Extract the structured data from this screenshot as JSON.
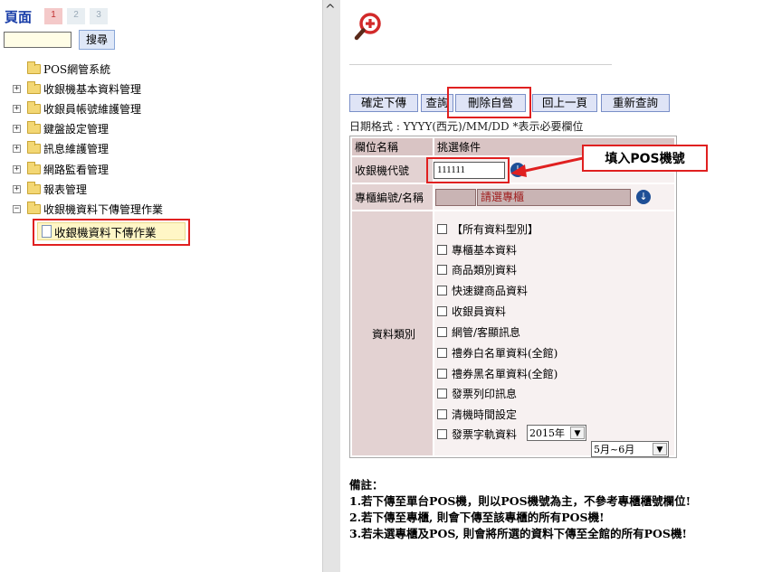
{
  "left": {
    "pager_label": "頁面",
    "pages": [
      "1",
      "2",
      "3"
    ],
    "search_button": "搜尋",
    "tree": [
      {
        "label": "POS網管系統",
        "expander": ""
      },
      {
        "label": "收銀機基本資料管理",
        "expander": "+"
      },
      {
        "label": "收銀員帳號維護管理",
        "expander": "+"
      },
      {
        "label": "鍵盤設定管理",
        "expander": "+"
      },
      {
        "label": "訊息維護管理",
        "expander": "+"
      },
      {
        "label": "網路監看管理",
        "expander": "+"
      },
      {
        "label": "報表管理",
        "expander": "+"
      },
      {
        "label": "收銀機資料下傳管理作業",
        "expander": "−"
      }
    ],
    "selected_leaf": "收銀機資料下傳作業"
  },
  "toolbar": {
    "confirm": "確定下傳",
    "query": "查詢",
    "delete": "刪除自營",
    "back": "回上一頁",
    "requery": "重新查詢"
  },
  "date_note": "日期格式 : YYYY(西元)/MM/DD    *表示必要欄位",
  "form": {
    "col_field": "欄位名稱",
    "col_condition": "挑選條件",
    "pos_label": "收銀機代號",
    "pos_value": "111111",
    "counter_label": "專櫃編號/名稱",
    "counter_placeholder": "請選專櫃",
    "category_label": "資料類別",
    "categories": [
      "【所有資料型別】",
      "專櫃基本資料",
      "商品類別資料",
      "快速鍵商品資料",
      "收銀員資料",
      "網管/客顯訊息",
      "禮券白名單資料(全館)",
      "禮券黑名單資料(全館)",
      "發票列印訊息",
      "清機時間設定",
      "發票字軌資料"
    ],
    "year_select": "2015年",
    "month_select": "5月~6月"
  },
  "callout": "填入POS機號",
  "notes": {
    "title": "備註：",
    "lines": [
      "1.若下傳至單台POS機，則以POS機號為主，不參考專櫃櫃號欄位!",
      "2.若下傳至專櫃, 則會下傳至該專櫃的所有POS機!",
      "3.若未選專櫃及POS, 則會將所選的資料下傳至全館的所有POS機!"
    ]
  },
  "colors": {
    "highlight_red": "#e02020",
    "header_bg": "#d9c4c4",
    "button_bg": "#dfe4f6",
    "link_blue": "#1a3ea8"
  }
}
